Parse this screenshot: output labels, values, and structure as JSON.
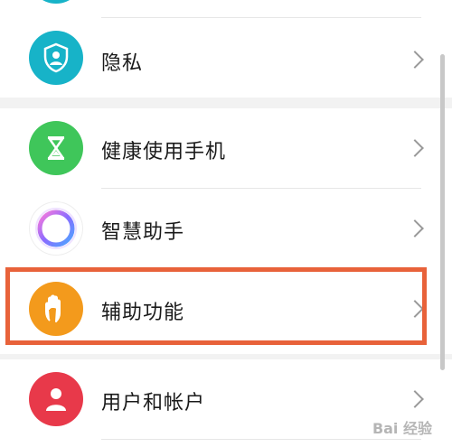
{
  "settings": {
    "items": [
      {
        "label": "隐私",
        "icon": "shield-person-icon",
        "color": "#17b3c8"
      },
      {
        "label": "健康使用手机",
        "icon": "hourglass-icon",
        "color": "#3fc65a"
      },
      {
        "label": "智慧助手",
        "icon": "assistant-ring-icon",
        "color": "#ffffff"
      },
      {
        "label": "辅助功能",
        "icon": "hand-icon",
        "color": "#f39a1c"
      },
      {
        "label": "用户和帐户",
        "icon": "person-icon",
        "color": "#e8394a"
      }
    ]
  },
  "watermark": "Bai 经验"
}
